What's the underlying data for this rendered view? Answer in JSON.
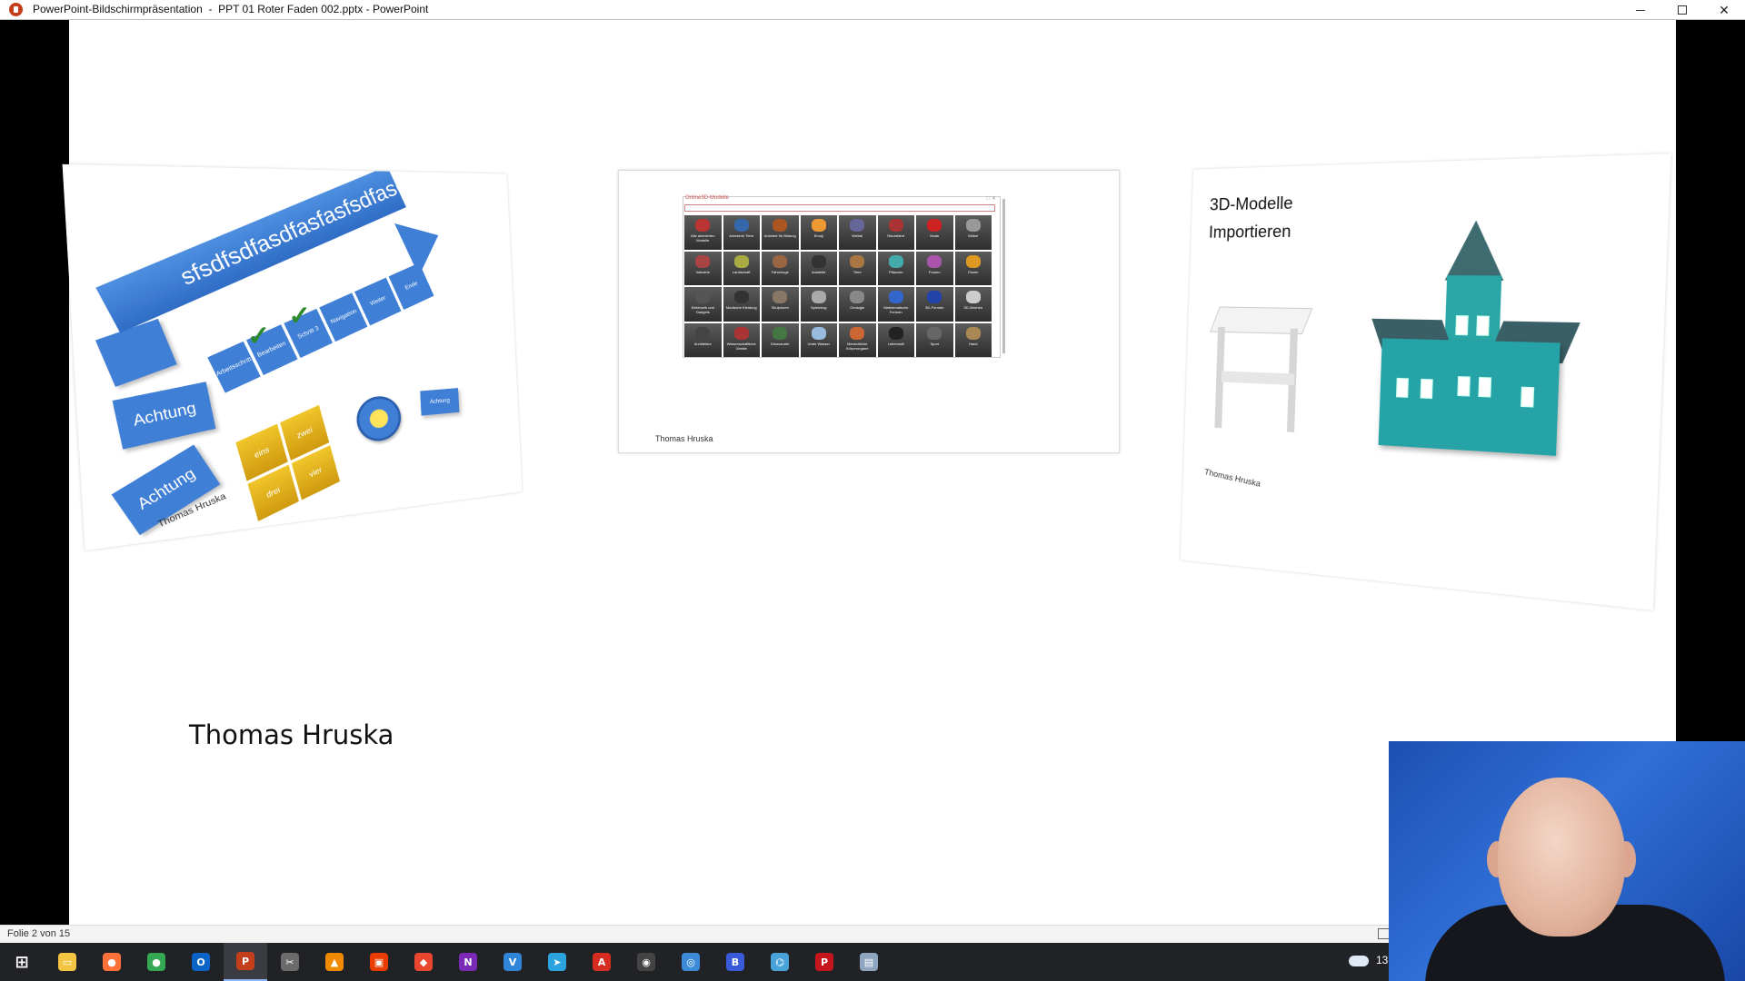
{
  "titlebar": {
    "title": "PowerPoint-Bildschirmpräsentation  -  PPT 01 Roter Faden 002.pptx - PowerPoint"
  },
  "slide": {
    "author": "Thomas Hruska",
    "left_card": {
      "arrow_text": "sfsdfsdfasdfasfasfsdfasdfasdfasdfada",
      "chevrons": [
        "Arbeitsschritt 1",
        "Bearbeiten",
        "Schritt 3",
        "Navigation",
        "Weiter",
        "Ende"
      ],
      "achtung_1": "Achtung",
      "achtung_2": "Achtung",
      "achtung_small": "Achtung",
      "gold": [
        "eins",
        "zwei",
        "drei",
        "vier"
      ],
      "author": "Thomas Hruska"
    },
    "center_card": {
      "gallery_title": "Online3D-Modelle",
      "tiles": [
        "Alle animierten Modelle",
        "Animierte Tiere",
        "Animiert für Bildung",
        "Emoji",
        "Weltall",
        "Raumfahrt",
        "Mode",
        "Möbel",
        "Industrie",
        "Landschaft",
        "Fahrzeuge",
        "Autoteile",
        "Tiere",
        "Pflanzen",
        "Frauen",
        "Essen",
        "Elektronik und Gadgets",
        "Modische Kleidung",
        "Skulpturen",
        "Spielzeug",
        "Geologie",
        "Mathematische Formen",
        "3D-Formen",
        "3D-Zeichen",
        "Architektur",
        "Wissenschaftliche Geräte",
        "Dinosaurier",
        "Unter Wasser",
        "Menschliche Körperorgane",
        "Lebensstil",
        "Sport",
        "Hand"
      ],
      "author": "Thomas Hruska"
    },
    "right_card": {
      "title_line1": "3D-Modelle",
      "title_line2": "Importieren",
      "author": "Thomas Hruska"
    }
  },
  "statusbar": {
    "slide_counter": "Folie 2 von 15"
  },
  "taskbar": {
    "items": [
      {
        "name": "start-icon",
        "glyph": "⊞",
        "color": "#ffffff"
      },
      {
        "name": "file-explorer-icon",
        "glyph": "▭",
        "color": "#f4c542"
      },
      {
        "name": "firefox-icon",
        "glyph": "●",
        "color": "#ff7139"
      },
      {
        "name": "chrome-icon",
        "glyph": "●",
        "color": "#34a853"
      },
      {
        "name": "outlook-icon",
        "glyph": "O",
        "color": "#0a64c8"
      },
      {
        "name": "powerpoint-icon",
        "glyph": "P",
        "color": "#c43e1c"
      },
      {
        "name": "snip-icon",
        "glyph": "✂",
        "color": "#6b6b6b"
      },
      {
        "name": "vlc-icon",
        "glyph": "▲",
        "color": "#f08a00"
      },
      {
        "name": "office-icon",
        "glyph": "▣",
        "color": "#eb3c00"
      },
      {
        "name": "app-red-icon",
        "glyph": "◆",
        "color": "#e8462f"
      },
      {
        "name": "onenote-icon",
        "glyph": "N",
        "color": "#7b2ab8"
      },
      {
        "name": "v-app-icon",
        "glyph": "V",
        "color": "#2f86d8"
      },
      {
        "name": "telegram-icon",
        "glyph": "➤",
        "color": "#2aa3df"
      },
      {
        "name": "pdf-app-icon",
        "glyph": "A",
        "color": "#d62d20"
      },
      {
        "name": "obs-icon",
        "glyph": "◉",
        "color": "#444444"
      },
      {
        "name": "circle-app-icon",
        "glyph": "◎",
        "color": "#3d8bd8"
      },
      {
        "name": "blue-app-icon",
        "glyph": "B",
        "color": "#3a5bd9"
      },
      {
        "name": "network-app-icon",
        "glyph": "⌬",
        "color": "#4aa3d8"
      },
      {
        "name": "pdf-editor-icon",
        "glyph": "P",
        "color": "#c4161c"
      },
      {
        "name": "monitor-app-icon",
        "glyph": "▤",
        "color": "#8fa6c0"
      }
    ],
    "clock_partial": "13"
  }
}
